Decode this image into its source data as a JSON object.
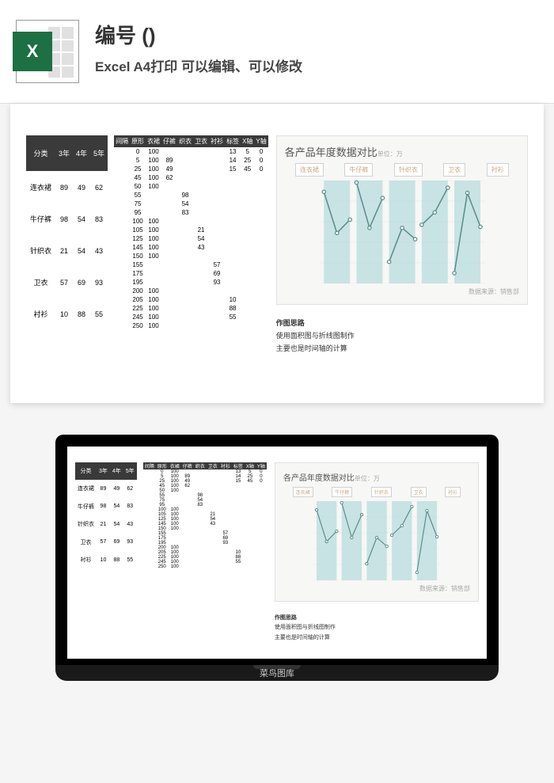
{
  "header": {
    "title": "编号 ()",
    "subtitle": "Excel A4打印 可以编辑、可以修改"
  },
  "table1": {
    "headers": [
      "分类",
      "3年",
      "4年",
      "5年"
    ],
    "rows": [
      [
        "连衣裙",
        "89",
        "49",
        "62"
      ],
      [
        "牛仔裤",
        "98",
        "54",
        "83"
      ],
      [
        "针织衣",
        "21",
        "54",
        "43"
      ],
      [
        "卫衣",
        "57",
        "69",
        "93"
      ],
      [
        "衬衫",
        "10",
        "88",
        "55"
      ]
    ]
  },
  "table2": {
    "headers": [
      "间隔",
      "原形",
      "衣裙",
      "仔裤",
      "织衣",
      "卫衣",
      "衬衫",
      "标签",
      "X轴",
      "Y轴"
    ],
    "rows": [
      [
        "",
        "0",
        "100",
        "",
        "",
        "",
        "",
        "13",
        "5",
        "0"
      ],
      [
        "",
        "5",
        "100",
        "89",
        "",
        "",
        "",
        "14",
        "25",
        "0"
      ],
      [
        "",
        "25",
        "100",
        "49",
        "",
        "",
        "",
        "15",
        "45",
        "0"
      ],
      [
        "",
        "45",
        "100",
        "62",
        "",
        "",
        "",
        "",
        "",
        ""
      ],
      [
        "",
        "50",
        "100",
        "",
        "",
        "",
        "",
        "",
        "",
        ""
      ],
      [
        "",
        "55",
        "",
        "",
        "98",
        "",
        "",
        "",
        "",
        ""
      ],
      [
        "",
        "75",
        "",
        "",
        "54",
        "",
        "",
        "",
        "",
        ""
      ],
      [
        "",
        "95",
        "",
        "",
        "83",
        "",
        "",
        "",
        "",
        ""
      ],
      [
        "",
        "100",
        "100",
        "",
        "",
        "",
        "",
        "",
        "",
        ""
      ],
      [
        "",
        "105",
        "100",
        "",
        "",
        "21",
        "",
        "",
        "",
        ""
      ],
      [
        "",
        "125",
        "100",
        "",
        "",
        "54",
        "",
        "",
        "",
        ""
      ],
      [
        "",
        "145",
        "100",
        "",
        "",
        "43",
        "",
        "",
        "",
        ""
      ],
      [
        "",
        "150",
        "100",
        "",
        "",
        "",
        "",
        "",
        "",
        ""
      ],
      [
        "",
        "155",
        "",
        "",
        "",
        "",
        "57",
        "",
        "",
        ""
      ],
      [
        "",
        "175",
        "",
        "",
        "",
        "",
        "69",
        "",
        "",
        ""
      ],
      [
        "",
        "195",
        "",
        "",
        "",
        "",
        "93",
        "",
        "",
        ""
      ],
      [
        "",
        "200",
        "100",
        "",
        "",
        "",
        "",
        "",
        "",
        ""
      ],
      [
        "",
        "205",
        "100",
        "",
        "",
        "",
        "",
        "10",
        "",
        ""
      ],
      [
        "",
        "225",
        "100",
        "",
        "",
        "",
        "",
        "88",
        "",
        ""
      ],
      [
        "",
        "245",
        "100",
        "",
        "",
        "",
        "",
        "55",
        "",
        ""
      ],
      [
        "",
        "250",
        "100",
        "",
        "",
        "",
        "",
        "",
        "",
        ""
      ]
    ]
  },
  "chart": {
    "title": "各产品年度数据对比",
    "unit": "单位：万",
    "legend": [
      "连衣裙",
      "牛仔裤",
      "针织衣",
      "卫衣",
      "衬衫"
    ],
    "footer": "数据来源：销售部"
  },
  "notes": {
    "title": "作图思路",
    "line1": "使用面积图与折线图制作",
    "line2": "主要也是时间轴的计算"
  },
  "laptop": {
    "brand": "菜鸟图库"
  },
  "chart_data": {
    "type": "line",
    "title": "各产品年度数据对比",
    "xlabel": "",
    "ylabel": "",
    "ylim": [
      0,
      100
    ],
    "categories": [
      "3年",
      "4年",
      "5年"
    ],
    "series": [
      {
        "name": "连衣裙",
        "values": [
          89,
          49,
          62
        ]
      },
      {
        "name": "牛仔裤",
        "values": [
          98,
          54,
          83
        ]
      },
      {
        "name": "针织衣",
        "values": [
          21,
          54,
          43
        ]
      },
      {
        "name": "卫衣",
        "values": [
          57,
          69,
          93
        ]
      },
      {
        "name": "衬衫",
        "values": [
          10,
          88,
          55
        ]
      }
    ]
  }
}
